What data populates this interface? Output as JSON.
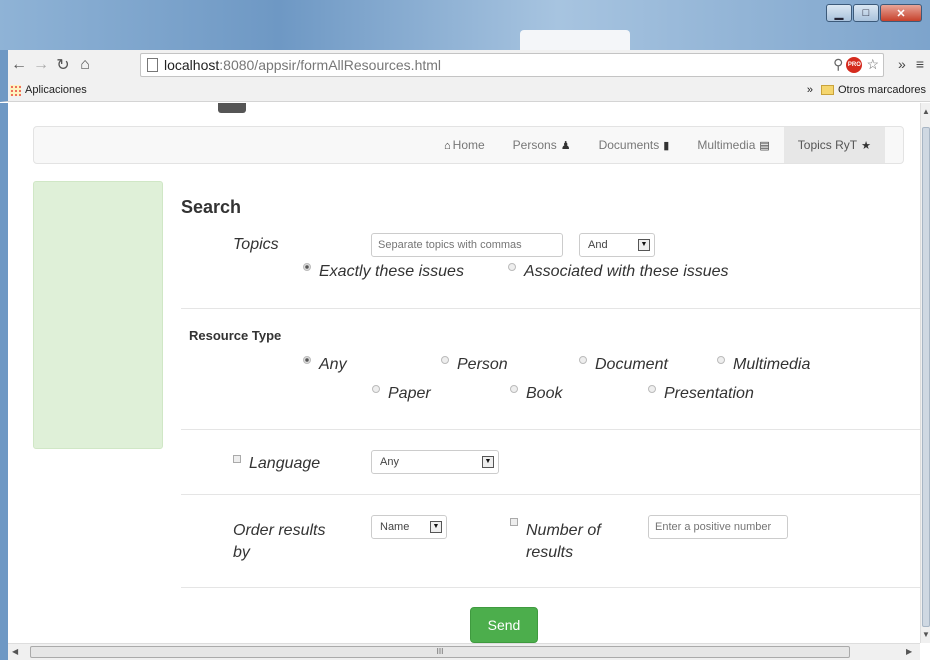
{
  "browser": {
    "url_host": "localhost",
    "url_path": ":8080/appsir/formAllResources.html",
    "bookmarks_apps": "Aplicaciones",
    "bookmarks_other": "Otros marcadores",
    "bookmarks_chevron": "»",
    "pro_badge": "PRO"
  },
  "nav": {
    "home": "Home",
    "persons": "Persons",
    "documents": "Documents",
    "multimedia": "Multimedia",
    "topics": "Topics RyT"
  },
  "form": {
    "title": "Search",
    "topics_label": "Topics",
    "topics_placeholder": "Separate topics with commas",
    "topics_operator": "And",
    "topic_mode_exact": "Exactly these issues",
    "topic_mode_assoc": "Associated with these issues",
    "resource_type_title": "Resource Type",
    "types": {
      "any": "Any",
      "person": "Person",
      "document": "Document",
      "multimedia": "Multimedia",
      "paper": "Paper",
      "book": "Book",
      "presentation": "Presentation"
    },
    "language_label": "Language",
    "language_value": "Any",
    "order_label_1": "Order results",
    "order_label_2": "by",
    "order_value": "Name",
    "number_label_1": "Number of",
    "number_label_2": "results",
    "number_placeholder": "Enter a positive number",
    "send_label": "Send"
  },
  "scrollbar": {
    "h_thumb_grip": "III"
  }
}
